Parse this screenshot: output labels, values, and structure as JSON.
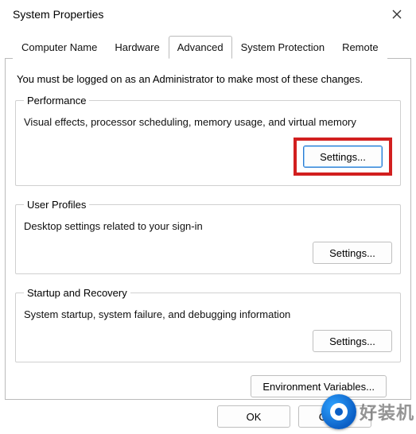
{
  "window": {
    "title": "System Properties"
  },
  "tabs": [
    {
      "label": "Computer Name"
    },
    {
      "label": "Hardware"
    },
    {
      "label": "Advanced"
    },
    {
      "label": "System Protection"
    },
    {
      "label": "Remote"
    }
  ],
  "intro": "You must be logged on as an Administrator to make most of these changes.",
  "performance": {
    "legend": "Performance",
    "desc": "Visual effects, processor scheduling, memory usage, and virtual memory",
    "button": "Settings..."
  },
  "userProfiles": {
    "legend": "User Profiles",
    "desc": "Desktop settings related to your sign-in",
    "button": "Settings..."
  },
  "startup": {
    "legend": "Startup and Recovery",
    "desc": "System startup, system failure, and debugging information",
    "button": "Settings..."
  },
  "env": {
    "button": "Environment Variables..."
  },
  "footer": {
    "ok": "OK",
    "cancel": "Cancel"
  },
  "watermark": {
    "text": "好装机"
  }
}
